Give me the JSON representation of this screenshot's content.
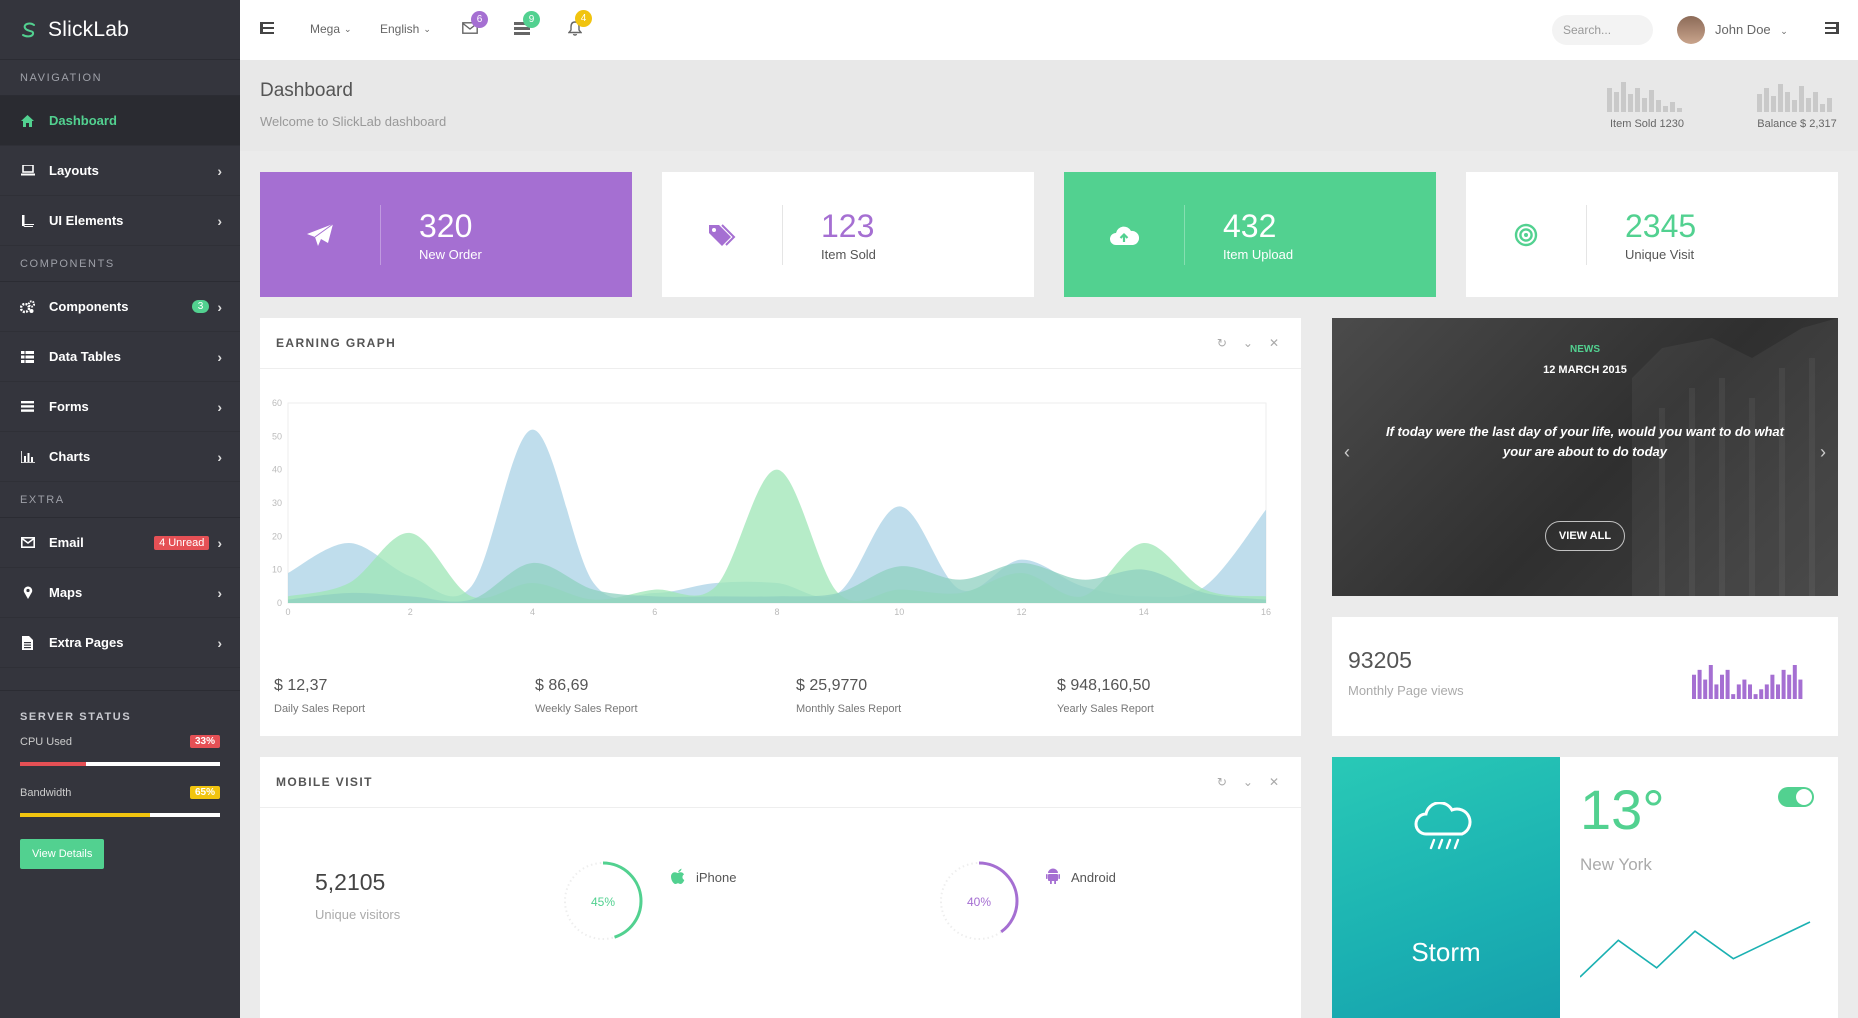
{
  "brand": {
    "name": "SlickLab"
  },
  "sidebar": {
    "sections": {
      "navigation": "NAVIGATION",
      "components": "COMPONENTS",
      "extra": "EXTRA"
    },
    "items": [
      {
        "label": "Dashboard",
        "icon": "home-icon"
      },
      {
        "label": "Layouts",
        "icon": "laptop-icon"
      },
      {
        "label": "UI Elements",
        "icon": "book-icon"
      },
      {
        "label": "Components",
        "icon": "gears-icon",
        "badge": "3"
      },
      {
        "label": "Data Tables",
        "icon": "table-icon"
      },
      {
        "label": "Forms",
        "icon": "form-icon"
      },
      {
        "label": "Charts",
        "icon": "bar-chart-icon"
      },
      {
        "label": "Email",
        "icon": "envelope-icon",
        "badge": "4 Unread"
      },
      {
        "label": "Maps",
        "icon": "map-marker-icon"
      },
      {
        "label": "Extra Pages",
        "icon": "file-icon"
      }
    ],
    "server": {
      "title": "SERVER STATUS",
      "cpu_label": "CPU Used",
      "cpu_value": "33%",
      "cpu_fraction": 0.33,
      "bw_label": "Bandwidth",
      "bw_value": "65%",
      "bw_fraction": 0.65,
      "button": "View Details"
    }
  },
  "topbar": {
    "mega": "Mega",
    "language": "English",
    "mail_count": "6",
    "tasks_count": "9",
    "notif_count": "4",
    "search_placeholder": "Search...",
    "user_name": "John Doe"
  },
  "header": {
    "title": "Dashboard",
    "subtitle": "Welcome to SlickLab dashboard",
    "item_sold": "Item Sold 1230",
    "balance": "Balance $ 2,317"
  },
  "stats": [
    {
      "value": "320",
      "label": "New Order",
      "icon": "paper-plane-icon"
    },
    {
      "value": "123",
      "label": "Item Sold",
      "icon": "tags-icon"
    },
    {
      "value": "432",
      "label": "Item Upload",
      "icon": "cloud-upload-icon"
    },
    {
      "value": "2345",
      "label": "Unique Visit",
      "icon": "bullseye-icon"
    }
  ],
  "earning": {
    "title": "EARNING GRAPH",
    "reports": [
      {
        "value": "$ 12,37",
        "label": "Daily Sales Report"
      },
      {
        "value": "$ 86,69",
        "label": "Weekly Sales Report"
      },
      {
        "value": "$ 25,9770",
        "label": "Monthly Sales Report"
      },
      {
        "value": "$ 948,160,50",
        "label": "Yearly Sales Report"
      }
    ]
  },
  "chart_data": {
    "type": "area",
    "x": [
      0,
      1,
      2,
      3,
      4,
      5,
      6,
      7,
      8,
      9,
      10,
      11,
      12,
      13,
      14,
      15,
      16
    ],
    "x_ticks": [
      "0",
      "2",
      "4",
      "6",
      "8",
      "10",
      "12",
      "14",
      "16"
    ],
    "y_ticks": [
      "0",
      "10",
      "20",
      "30",
      "40",
      "50",
      "60"
    ],
    "ylim": [
      0,
      60
    ],
    "xlim": [
      0,
      16
    ],
    "grid": false,
    "series": [
      {
        "color": "#a9d2e6",
        "values": [
          9,
          18,
          8,
          5,
          52,
          6,
          3,
          6,
          6,
          3,
          29,
          4,
          13,
          5,
          2,
          5,
          28
        ]
      },
      {
        "color": "#9ee6b6",
        "values": [
          2,
          6,
          21,
          2,
          6,
          1,
          4,
          5,
          40,
          3,
          4,
          3,
          9,
          2,
          18,
          4,
          2
        ]
      },
      {
        "color": "#8fd0c0",
        "values": [
          1,
          3,
          2,
          1,
          12,
          4,
          2,
          2,
          2,
          3,
          11,
          7,
          12,
          7,
          10,
          3,
          1
        ]
      }
    ]
  },
  "news": {
    "tag": "NEWS",
    "date": "12 MARCH 2015",
    "quote": "If today were the last day of your life, would you want to do what your are about to do today",
    "button": "VIEW ALL"
  },
  "pageviews": {
    "value": "93205",
    "label": "Monthly Page views",
    "bars": [
      5,
      6,
      4,
      7,
      3,
      5,
      6,
      1,
      3,
      4,
      3,
      1,
      2,
      3,
      5,
      3,
      6,
      5,
      7,
      4
    ]
  },
  "mobile": {
    "title": "MOBILE VISIT",
    "visitors": "5,2105",
    "visitors_label": "Unique visitors",
    "iphone_pct": "45%",
    "iphone_fraction": 0.45,
    "iphone_label": "iPhone",
    "android_pct": "40%",
    "android_fraction": 0.4,
    "android_label": "Android"
  },
  "weather": {
    "condition": "Storm",
    "temp": "13°",
    "city": "New York",
    "spark": [
      2,
      6,
      3,
      7,
      4,
      6,
      8
    ]
  },
  "colors": {
    "accent": "#52d190",
    "purple": "#a56fd2",
    "teal": "#1bb1b2"
  }
}
